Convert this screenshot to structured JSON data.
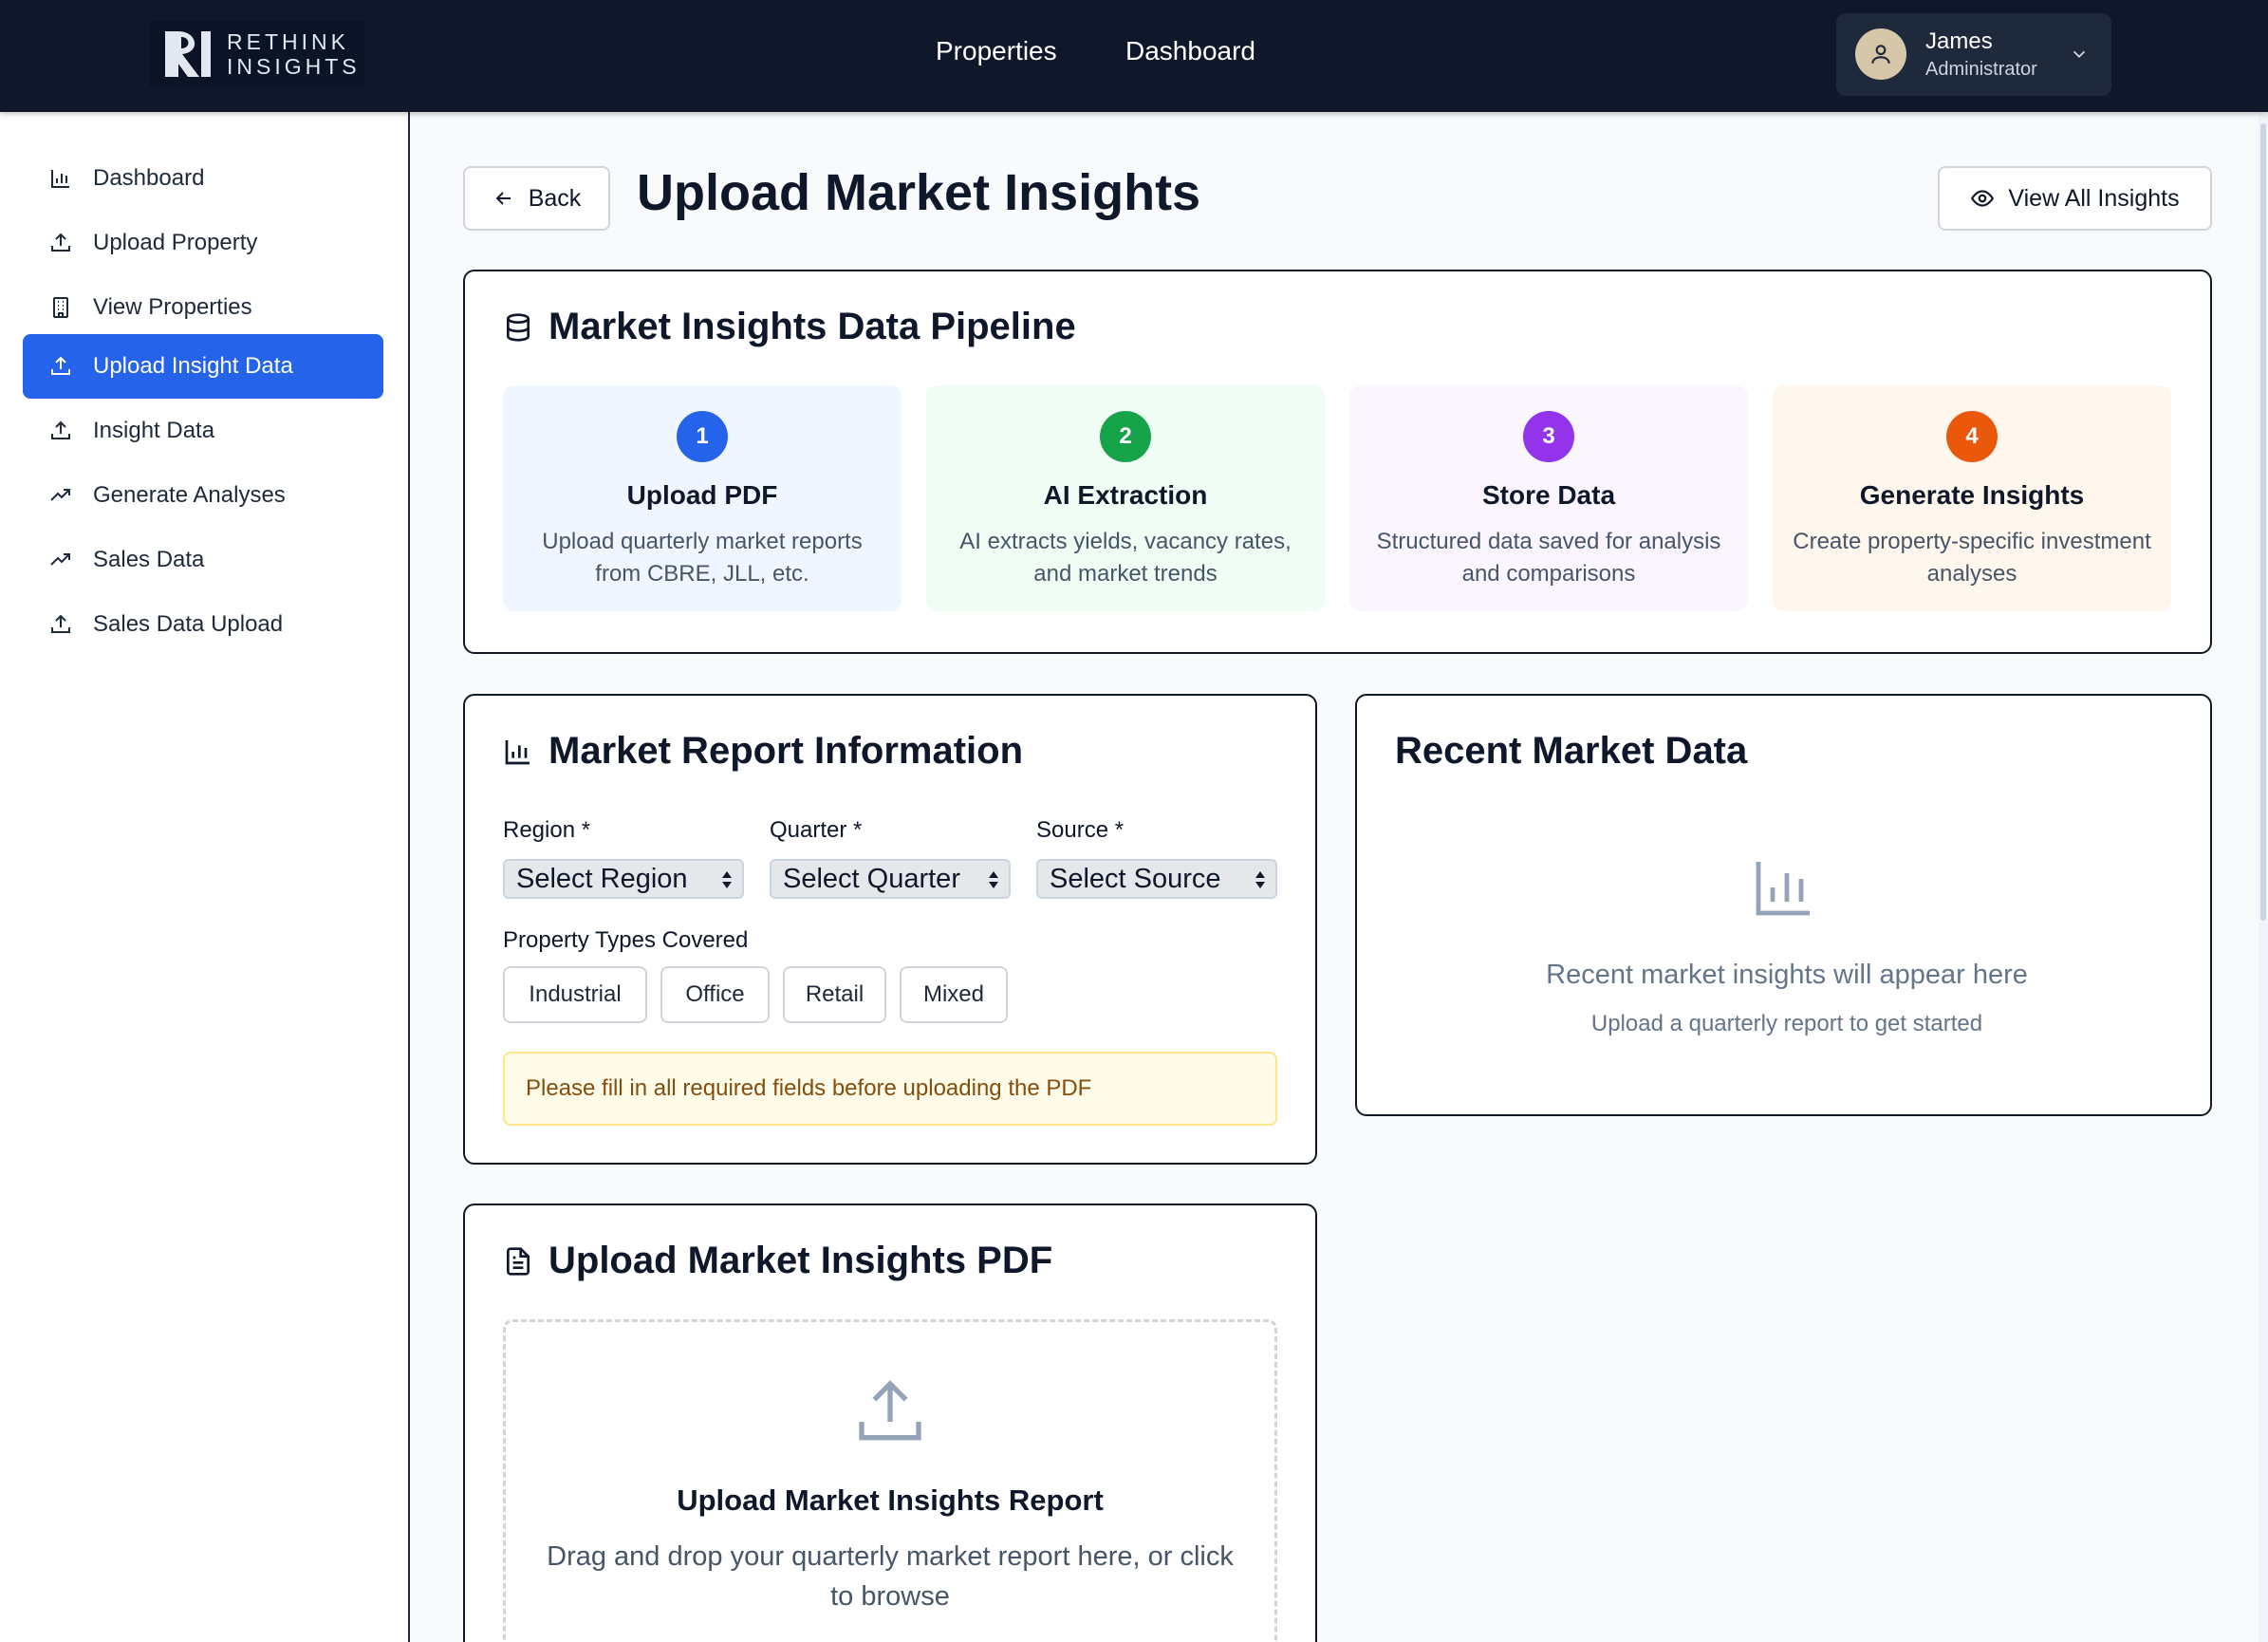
{
  "header": {
    "logo_line1": "RETHINK",
    "logo_line2": "INSIGHTS",
    "nav": [
      "Properties",
      "Dashboard"
    ],
    "user": {
      "name": "James",
      "role": "Administrator"
    }
  },
  "sidebar": {
    "items": [
      {
        "label": "Dashboard",
        "icon": "bar-chart-icon"
      },
      {
        "label": "Upload Property",
        "icon": "upload-icon"
      },
      {
        "label": "View Properties",
        "icon": "building-icon"
      },
      {
        "label": "Upload Insight Data",
        "icon": "upload-icon",
        "active": true
      },
      {
        "label": "Insight Data",
        "icon": "upload-icon"
      },
      {
        "label": "Generate Analyses",
        "icon": "trending-up-icon"
      },
      {
        "label": "Sales Data",
        "icon": "trending-up-icon"
      },
      {
        "label": "Sales Data Upload",
        "icon": "upload-icon"
      }
    ],
    "active_color": "#2563eb"
  },
  "page": {
    "back_label": "Back",
    "title": "Upload Market Insights",
    "view_all_label": "View All Insights"
  },
  "pipeline": {
    "title": "Market Insights Data Pipeline",
    "steps": [
      {
        "num": "1",
        "title": "Upload PDF",
        "desc": "Upload quarterly market reports from CBRE, JLL, etc.",
        "color": "#2563eb",
        "bg": "#eff6ff"
      },
      {
        "num": "2",
        "title": "AI Extraction",
        "desc": "AI extracts yields, vacancy rates, and market trends",
        "color": "#16a34a",
        "bg": "#f0fdf4"
      },
      {
        "num": "3",
        "title": "Store Data",
        "desc": "Structured data saved for analysis and comparisons",
        "color": "#9333ea",
        "bg": "#faf5ff"
      },
      {
        "num": "4",
        "title": "Generate Insights",
        "desc": "Create property-specific investment analyses",
        "color": "#ea580c",
        "bg": "#fff7ed"
      }
    ]
  },
  "report_info": {
    "title": "Market Report Information",
    "region_label": "Region *",
    "region_value": "Select Region",
    "quarter_label": "Quarter *",
    "quarter_value": "Select Quarter",
    "source_label": "Source *",
    "source_value": "Select Source",
    "property_types_label": "Property Types Covered",
    "property_types": [
      "Industrial",
      "Office",
      "Retail",
      "Mixed"
    ],
    "warning": "Please fill in all required fields before uploading the PDF"
  },
  "recent": {
    "title": "Recent Market Data",
    "empty_main": "Recent market insights will appear here",
    "empty_sub": "Upload a quarterly report to get started"
  },
  "upload_pdf": {
    "title": "Upload Market Insights PDF",
    "dz_title": "Upload Market Insights Report",
    "dz_desc": "Drag and drop your quarterly market report here, or click to browse"
  }
}
